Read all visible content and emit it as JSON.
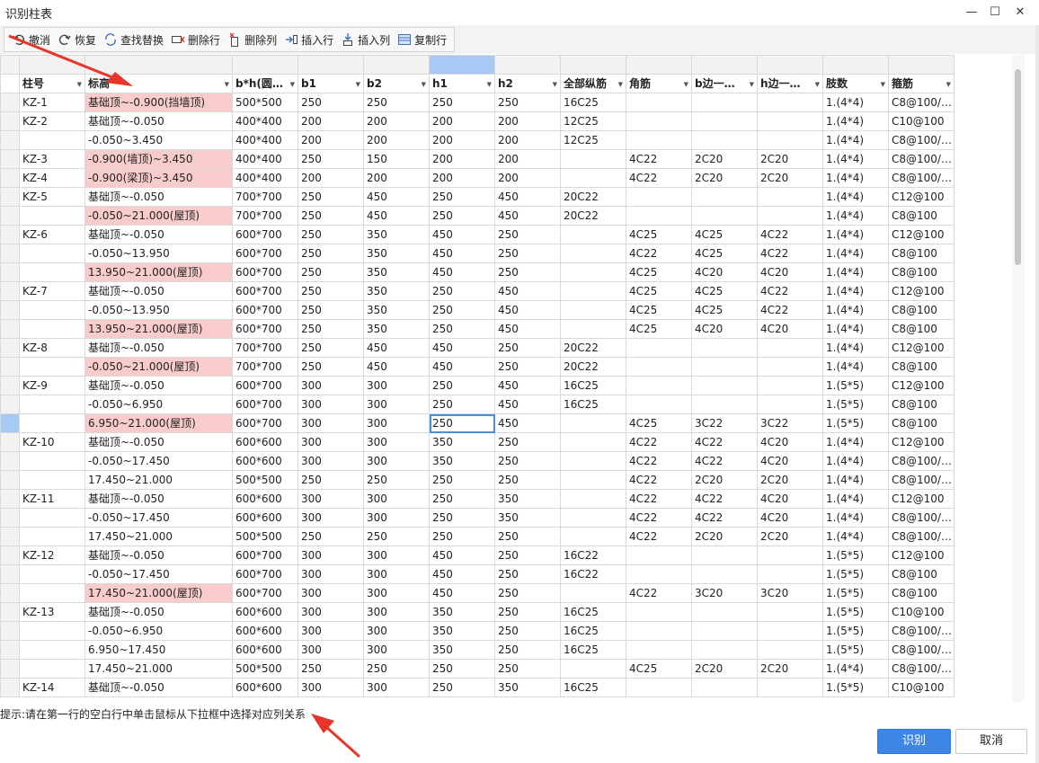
{
  "window": {
    "title": "识别柱表",
    "minimize": "—",
    "maximize": "☐",
    "close": "✕"
  },
  "toolbar": {
    "undo": "撤消",
    "redo": "恢复",
    "find_replace": "查找替换",
    "delete_row": "删除行",
    "delete_col": "删除列",
    "insert_row": "插入行",
    "insert_col": "插入列",
    "copy_row": "复制行"
  },
  "columns": [
    "柱号",
    "标高",
    "b*h(圆…",
    "b1",
    "b2",
    "h1",
    "h2",
    "全部纵筋",
    "角筋",
    "b边一…",
    "h边一…",
    "肢数",
    "箍筋"
  ],
  "rows": [
    [
      "KZ-1",
      "基础顶~-0.900(挡墙顶)",
      "500*500",
      "250",
      "250",
      "250",
      "250",
      "16C25",
      "",
      "",
      "",
      "1.(4*4)",
      "C8@100/…"
    ],
    [
      "KZ-2",
      "基础顶~-0.050",
      "400*400",
      "200",
      "200",
      "200",
      "200",
      "12C25",
      "",
      "",
      "",
      "1.(4*4)",
      "C10@100"
    ],
    [
      "",
      "-0.050~3.450",
      "400*400",
      "200",
      "200",
      "200",
      "200",
      "12C25",
      "",
      "",
      "",
      "1.(4*4)",
      "C8@100/…"
    ],
    [
      "KZ-3",
      "-0.900(墙顶)~3.450",
      "400*400",
      "250",
      "150",
      "200",
      "200",
      "",
      "4C22",
      "2C20",
      "2C20",
      "1.(4*4)",
      "C8@100/…"
    ],
    [
      "KZ-4",
      "-0.900(梁顶)~3.450",
      "400*400",
      "200",
      "200",
      "200",
      "200",
      "",
      "4C22",
      "2C20",
      "2C20",
      "1.(4*4)",
      "C8@100/…"
    ],
    [
      "KZ-5",
      "基础顶~-0.050",
      "700*700",
      "250",
      "450",
      "250",
      "450",
      "20C22",
      "",
      "",
      "",
      "1.(4*4)",
      "C12@100"
    ],
    [
      "",
      "-0.050~21.000(屋顶)",
      "700*700",
      "250",
      "450",
      "250",
      "450",
      "20C22",
      "",
      "",
      "",
      "1.(4*4)",
      "C8@100"
    ],
    [
      "KZ-6",
      "基础顶~-0.050",
      "600*700",
      "250",
      "350",
      "450",
      "250",
      "",
      "4C25",
      "4C25",
      "4C22",
      "1.(4*4)",
      "C12@100"
    ],
    [
      "",
      "-0.050~13.950",
      "600*700",
      "250",
      "350",
      "450",
      "250",
      "",
      "4C22",
      "4C25",
      "4C22",
      "1.(4*4)",
      "C8@100"
    ],
    [
      "",
      "13.950~21.000(屋顶)",
      "600*700",
      "250",
      "350",
      "450",
      "250",
      "",
      "4C25",
      "4C20",
      "4C20",
      "1.(4*4)",
      "C8@100"
    ],
    [
      "KZ-7",
      "基础顶~-0.050",
      "600*700",
      "250",
      "350",
      "250",
      "450",
      "",
      "4C25",
      "4C25",
      "4C22",
      "1.(4*4)",
      "C12@100"
    ],
    [
      "",
      "-0.050~13.950",
      "600*700",
      "250",
      "350",
      "250",
      "450",
      "",
      "4C25",
      "4C25",
      "4C22",
      "1.(4*4)",
      "C8@100"
    ],
    [
      "",
      "13.950~21.000(屋顶)",
      "600*700",
      "250",
      "350",
      "250",
      "450",
      "",
      "4C25",
      "4C20",
      "4C20",
      "1.(4*4)",
      "C8@100"
    ],
    [
      "KZ-8",
      "基础顶~-0.050",
      "700*700",
      "250",
      "450",
      "450",
      "250",
      "20C22",
      "",
      "",
      "",
      "1.(4*4)",
      "C12@100"
    ],
    [
      "",
      "-0.050~21.000(屋顶)",
      "700*700",
      "250",
      "450",
      "450",
      "250",
      "20C22",
      "",
      "",
      "",
      "1.(4*4)",
      "C8@100"
    ],
    [
      "KZ-9",
      "基础顶~-0.050",
      "600*700",
      "300",
      "300",
      "250",
      "450",
      "16C25",
      "",
      "",
      "",
      "1.(5*5)",
      "C12@100"
    ],
    [
      "",
      "-0.050~6.950",
      "600*700",
      "300",
      "300",
      "250",
      "450",
      "16C25",
      "",
      "",
      "",
      "1.(5*5)",
      "C8@100"
    ],
    [
      "",
      "6.950~21.000(屋顶)",
      "600*700",
      "300",
      "300",
      "250",
      "450",
      "",
      "4C25",
      "3C22",
      "3C22",
      "1.(5*5)",
      "C8@100"
    ],
    [
      "KZ-10",
      "基础顶~-0.050",
      "600*600",
      "300",
      "300",
      "350",
      "250",
      "",
      "4C22",
      "4C22",
      "4C20",
      "1.(4*4)",
      "C12@100"
    ],
    [
      "",
      "-0.050~17.450",
      "600*600",
      "300",
      "300",
      "350",
      "250",
      "",
      "4C22",
      "4C22",
      "4C20",
      "1.(4*4)",
      "C8@100/…"
    ],
    [
      "",
      "17.450~21.000",
      "500*500",
      "250",
      "250",
      "250",
      "250",
      "",
      "4C22",
      "2C20",
      "2C20",
      "1.(4*4)",
      "C8@100/…"
    ],
    [
      "KZ-11",
      "基础顶~-0.050",
      "600*600",
      "300",
      "300",
      "250",
      "350",
      "",
      "4C22",
      "4C22",
      "4C20",
      "1.(4*4)",
      "C12@100"
    ],
    [
      "",
      "-0.050~17.450",
      "600*600",
      "300",
      "300",
      "250",
      "350",
      "",
      "4C22",
      "4C22",
      "4C20",
      "1.(4*4)",
      "C8@100/…"
    ],
    [
      "",
      "17.450~21.000",
      "500*500",
      "250",
      "250",
      "250",
      "250",
      "",
      "4C22",
      "2C20",
      "2C20",
      "1.(4*4)",
      "C8@100/…"
    ],
    [
      "KZ-12",
      "基础顶~-0.050",
      "600*700",
      "300",
      "300",
      "450",
      "250",
      "16C22",
      "",
      "",
      "",
      "1.(5*5)",
      "C12@100"
    ],
    [
      "",
      "-0.050~17.450",
      "600*700",
      "300",
      "300",
      "450",
      "250",
      "16C22",
      "",
      "",
      "",
      "1.(5*5)",
      "C8@100"
    ],
    [
      "",
      "17.450~21.000(屋顶)",
      "600*700",
      "300",
      "300",
      "450",
      "250",
      "",
      "4C22",
      "3C20",
      "3C20",
      "1.(5*5)",
      "C8@100"
    ],
    [
      "KZ-13",
      "基础顶~-0.050",
      "600*600",
      "300",
      "300",
      "350",
      "250",
      "16C25",
      "",
      "",
      "",
      "1.(5*5)",
      "C10@100"
    ],
    [
      "",
      "-0.050~6.950",
      "600*600",
      "300",
      "300",
      "350",
      "250",
      "16C25",
      "",
      "",
      "",
      "1.(5*5)",
      "C8@100/…"
    ],
    [
      "",
      "6.950~17.450",
      "600*600",
      "300",
      "300",
      "350",
      "250",
      "16C25",
      "",
      "",
      "",
      "1.(5*5)",
      "C8@100/…"
    ],
    [
      "",
      "17.450~21.000",
      "500*500",
      "250",
      "250",
      "250",
      "250",
      "",
      "4C25",
      "2C20",
      "2C20",
      "1.(4*4)",
      "C8@100/…"
    ],
    [
      "KZ-14",
      "基础顶~-0.050",
      "600*600",
      "300",
      "300",
      "250",
      "350",
      "16C25",
      "",
      "",
      "",
      "1.(5*5)",
      "C10@100"
    ]
  ],
  "pink_rows": [
    0,
    3,
    4,
    6,
    9,
    12,
    14,
    17,
    26
  ],
  "selected_row": 17,
  "selected_col": 5,
  "colors": {
    "pink": "#f9cccc",
    "selection": "#4a8fde",
    "accent": "#3e86e6",
    "arrow": "#e8352a"
  },
  "hint": "提示:请在第一行的空白行中单击鼠标从下拉框中选择对应列关系",
  "buttons": {
    "ok": "识别",
    "cancel": "取消"
  }
}
